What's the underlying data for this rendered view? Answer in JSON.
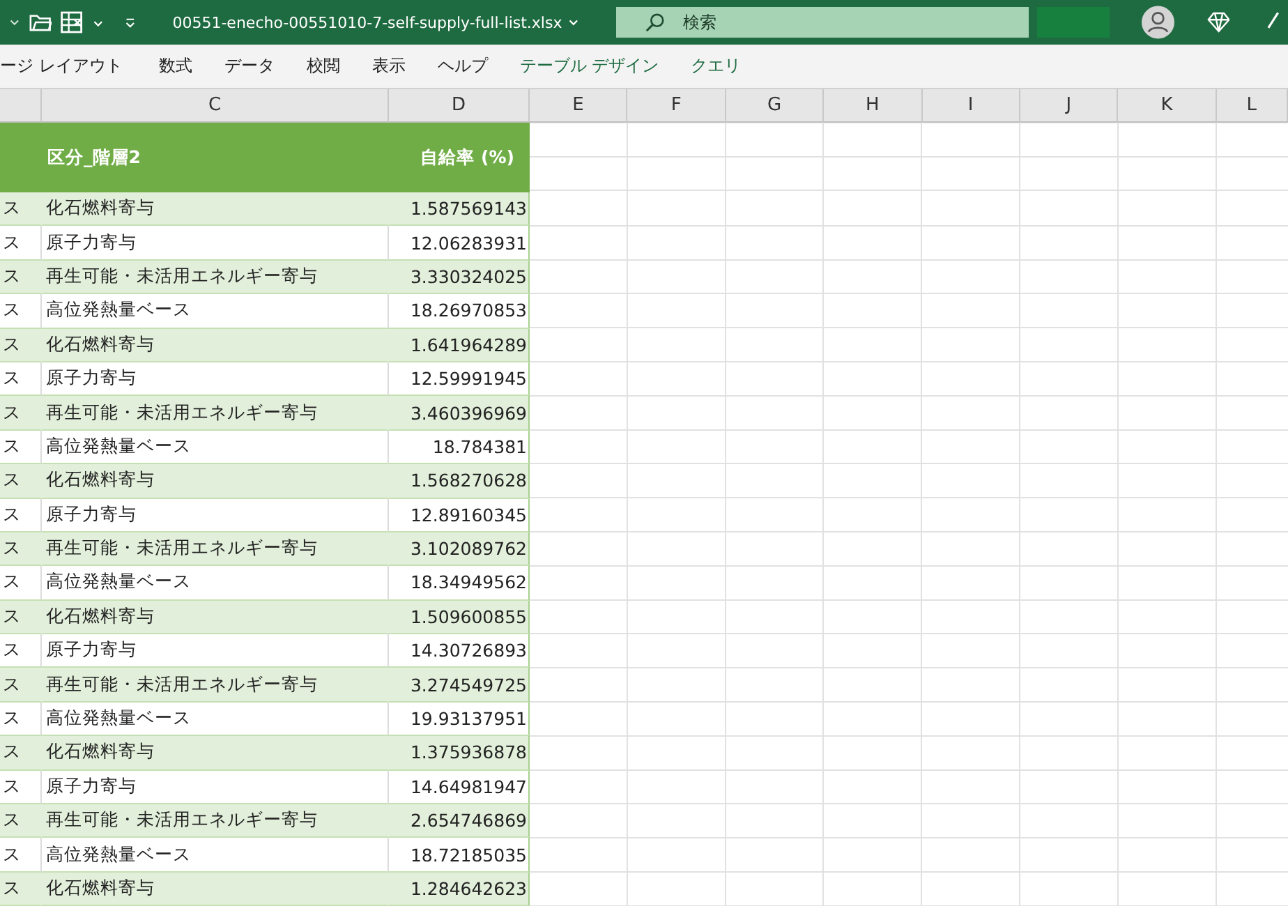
{
  "title_bar": {
    "filename": "00551-enecho-00551010-7-self-supply-full-list.xlsx",
    "search": {
      "placeholder": "検索"
    }
  },
  "ribbon_tabs": [
    {
      "label": "ージ レイアウト",
      "kind": "standard"
    },
    {
      "label": "数式",
      "kind": "standard"
    },
    {
      "label": "データ",
      "kind": "standard"
    },
    {
      "label": "校閲",
      "kind": "standard"
    },
    {
      "label": "表示",
      "kind": "standard"
    },
    {
      "label": "ヘルプ",
      "kind": "standard"
    },
    {
      "label": "テーブル デザイン",
      "kind": "contextual"
    },
    {
      "label": "クエリ",
      "kind": "contextual"
    }
  ],
  "column_headers": [
    "C",
    "D",
    "E",
    "F",
    "G",
    "H",
    "I",
    "J",
    "K",
    "L"
  ],
  "table": {
    "columns": [
      "区分_階層2",
      "自給率 (%)"
    ],
    "rows": [
      {
        "column_b": "ス",
        "category": "化石燃料寄与",
        "rate": "1.587569143"
      },
      {
        "column_b": "ス",
        "category": "原子力寄与",
        "rate": "12.06283931"
      },
      {
        "column_b": "ス",
        "category": "再生可能・未活用エネルギー寄与",
        "rate": "3.330324025"
      },
      {
        "column_b": "ス",
        "category": "高位発熱量ベース",
        "rate": "18.26970853"
      },
      {
        "column_b": "ス",
        "category": "化石燃料寄与",
        "rate": "1.641964289"
      },
      {
        "column_b": "ス",
        "category": "原子力寄与",
        "rate": "12.59991945"
      },
      {
        "column_b": "ス",
        "category": "再生可能・未活用エネルギー寄与",
        "rate": "3.460396969"
      },
      {
        "column_b": "ス",
        "category": "高位発熱量ベース",
        "rate": "18.784381"
      },
      {
        "column_b": "ス",
        "category": "化石燃料寄与",
        "rate": "1.568270628"
      },
      {
        "column_b": "ス",
        "category": "原子力寄与",
        "rate": "12.89160345"
      },
      {
        "column_b": "ス",
        "category": "再生可能・未活用エネルギー寄与",
        "rate": "3.102089762"
      },
      {
        "column_b": "ス",
        "category": "高位発熱量ベース",
        "rate": "18.34949562"
      },
      {
        "column_b": "ス",
        "category": "化石燃料寄与",
        "rate": "1.509600855"
      },
      {
        "column_b": "ス",
        "category": "原子力寄与",
        "rate": "14.30726893"
      },
      {
        "column_b": "ス",
        "category": "再生可能・未活用エネルギー寄与",
        "rate": "3.274549725"
      },
      {
        "column_b": "ス",
        "category": "高位発熱量ベース",
        "rate": "19.93137951"
      },
      {
        "column_b": "ス",
        "category": "化石燃料寄与",
        "rate": "1.375936878"
      },
      {
        "column_b": "ス",
        "category": "原子力寄与",
        "rate": "14.64981947"
      },
      {
        "column_b": "ス",
        "category": "再生可能・未活用エネルギー寄与",
        "rate": "2.654746869"
      },
      {
        "column_b": "ス",
        "category": "高位発熱量ベース",
        "rate": "18.72185035"
      },
      {
        "column_b": "ス",
        "category": "化石燃料寄与",
        "rate": "1.284642623"
      }
    ]
  }
}
